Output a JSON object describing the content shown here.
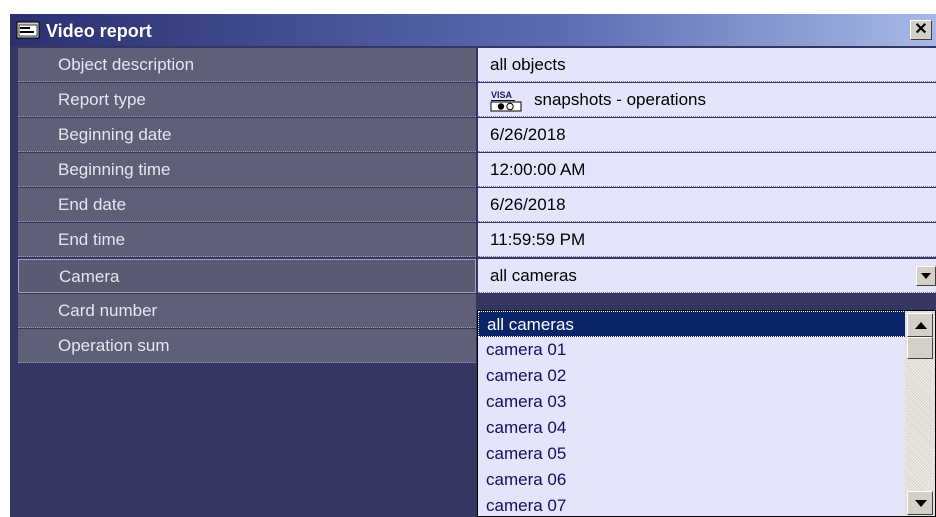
{
  "window": {
    "title": "Video report",
    "close_label": "✕"
  },
  "properties": [
    {
      "label": "Object description",
      "value": "all objects"
    },
    {
      "label": "Report type",
      "value": "snapshots - operations",
      "icon": "visa-card-icon"
    },
    {
      "label": "Beginning date",
      "value": "6/26/2018"
    },
    {
      "label": "Beginning time",
      "value": "12:00:00 AM"
    },
    {
      "label": "End date",
      "value": "6/26/2018"
    },
    {
      "label": "End time",
      "value": "11:59:59 PM"
    },
    {
      "label": "Camera",
      "value": "all cameras"
    },
    {
      "label": "Card number",
      "value": ""
    },
    {
      "label": "Operation sum",
      "value": ""
    }
  ],
  "camera_dropdown": {
    "selected": "all cameras",
    "options": [
      "all cameras",
      "camera 01",
      "camera 02",
      "camera 03",
      "camera 04",
      "camera 05",
      "camera 06",
      "camera 07"
    ]
  },
  "colors": {
    "title_start": "#2a2f6f",
    "label_bg": "#5f5f78",
    "value_bg": "#e4e4fa",
    "selection": "#0a246a"
  }
}
